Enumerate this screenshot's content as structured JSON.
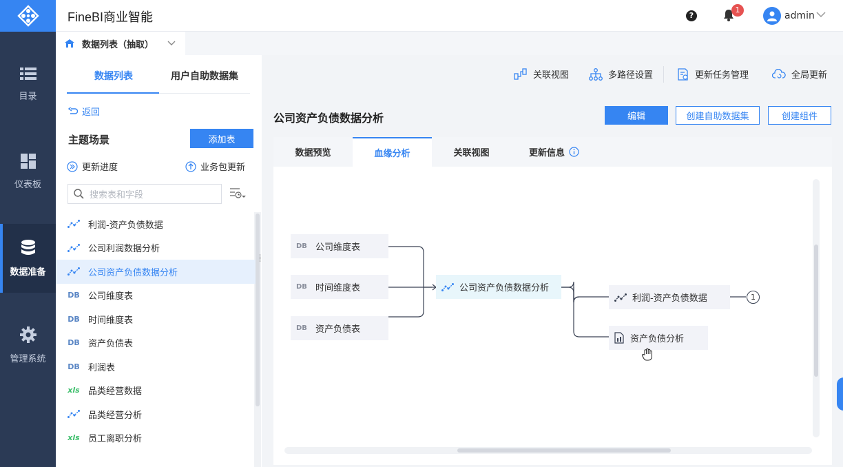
{
  "colors": {
    "accent": "#3685f2",
    "nav_bg": "#2b3a55",
    "badge": "#e65251",
    "xls_green": "#3fbf6d"
  },
  "app": {
    "title": "FineBI商业智能"
  },
  "nav": [
    {
      "label": "目录",
      "icon": "list-icon"
    },
    {
      "label": "仪表板",
      "icon": "dashboard-icon"
    },
    {
      "label": "数据准备",
      "icon": "database-icon",
      "active": true
    },
    {
      "label": "管理系统",
      "icon": "gear-icon"
    }
  ],
  "header": {
    "help": "?",
    "notification_count": "1",
    "user": "admin"
  },
  "doc_tab": {
    "label": "数据列表（抽取）"
  },
  "left": {
    "tabs": [
      "数据列表",
      "用户自助数据集"
    ],
    "back": "返回",
    "section_title": "主题场景",
    "add_table": "添加表",
    "update_progress": "更新进度",
    "package_update": "业务包更新",
    "search_placeholder": "搜索表和字段",
    "items": [
      {
        "label": "利润-资产负债数据",
        "type": "analysis"
      },
      {
        "label": "公司利润数据分析",
        "type": "analysis"
      },
      {
        "label": "公司资产负债数据分析",
        "type": "analysis",
        "active": true
      },
      {
        "label": "公司维度表",
        "type": "db"
      },
      {
        "label": "时间维度表",
        "type": "db"
      },
      {
        "label": "资产负债表",
        "type": "db"
      },
      {
        "label": "利润表",
        "type": "db"
      },
      {
        "label": "品类经营数据",
        "type": "xls"
      },
      {
        "label": "品类经营分析",
        "type": "analysis"
      },
      {
        "label": "员工离职分析",
        "type": "xls"
      }
    ]
  },
  "toolbar": {
    "relation_view": "关联视图",
    "multipath": "多路径设置",
    "task_mgmt": "更新任务管理",
    "global_update": "全局更新"
  },
  "main": {
    "title": "公司资产负债数据分析",
    "edit": "编辑",
    "create_dataset": "创建自助数据集",
    "create_component": "创建组件",
    "tabs": [
      "数据预览",
      "血缘分析",
      "关联视图",
      "更新信息"
    ],
    "active_tab": "血缘分析"
  },
  "lineage": {
    "db_tag": "DB",
    "sources": [
      "公司维度表",
      "时间维度表",
      "资产负债表"
    ],
    "center": "公司资产负债数据分析",
    "targets": [
      "利润-资产负债数据",
      "资产负债分析"
    ],
    "target_count": "1"
  }
}
